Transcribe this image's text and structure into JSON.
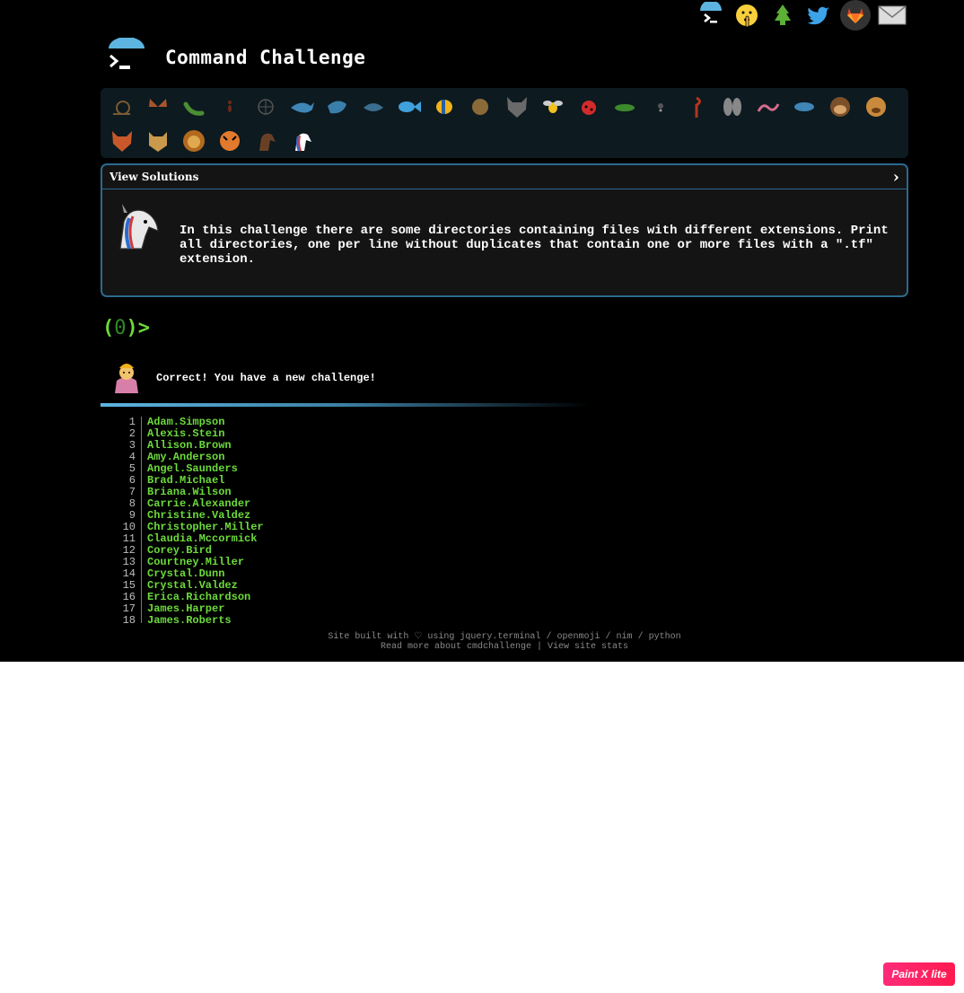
{
  "header": {
    "title": "Command Challenge",
    "icons": [
      "terminal-icon",
      "shushing-face-icon",
      "tree-icon",
      "twitter-icon",
      "gitlab-icon",
      "mail-icon"
    ]
  },
  "challenges": {
    "items": [
      "snail",
      "butterfly",
      "caterpillar",
      "ant",
      "snowflake",
      "whale",
      "dolphin",
      "dolphin-2",
      "fish",
      "tropical-fish",
      "blowfish",
      "wolf",
      "bee",
      "ladybug",
      "cricket",
      "spider",
      "scorpion",
      "fly",
      "worm",
      "microbe",
      "monkey",
      "dog",
      "fox",
      "cat",
      "lion",
      "tiger",
      "horse",
      "unicorn"
    ]
  },
  "panel": {
    "view_solutions": "View Solutions",
    "chevron": "›",
    "description": "In this challenge there are some directories containing files with different extensions. Print all directories, one per line without duplicates that contain one or more files with a \".tf\" extension."
  },
  "prompt": {
    "open": "(",
    "zero": "0",
    "close": ")>"
  },
  "result": {
    "text": "Correct! You have a new challenge!"
  },
  "output": [
    {
      "n": "1",
      "v": "Adam.Simpson"
    },
    {
      "n": "2",
      "v": "Alexis.Stein"
    },
    {
      "n": "3",
      "v": "Allison.Brown"
    },
    {
      "n": "4",
      "v": "Amy.Anderson"
    },
    {
      "n": "5",
      "v": "Angel.Saunders"
    },
    {
      "n": "6",
      "v": "Brad.Michael"
    },
    {
      "n": "7",
      "v": "Briana.Wilson"
    },
    {
      "n": "8",
      "v": "Carrie.Alexander"
    },
    {
      "n": "9",
      "v": "Christine.Valdez"
    },
    {
      "n": "10",
      "v": "Christopher.Miller"
    },
    {
      "n": "11",
      "v": "Claudia.Mccormick"
    },
    {
      "n": "12",
      "v": "Corey.Bird"
    },
    {
      "n": "13",
      "v": "Courtney.Miller"
    },
    {
      "n": "14",
      "v": "Crystal.Dunn"
    },
    {
      "n": "15",
      "v": "Crystal.Valdez"
    },
    {
      "n": "16",
      "v": "Erica.Richardson"
    },
    {
      "n": "17",
      "v": "James.Harper"
    },
    {
      "n": "18",
      "v": "James.Roberts"
    }
  ],
  "footer": {
    "line1_prefix": "Site built with ♡ using",
    "link_jquery": "jquery.terminal",
    "sep1": "/",
    "link_openmoji": "openmoji",
    "sep2": "/",
    "link_nim": "nim",
    "sep3": "/",
    "link_python": "python",
    "link_readmore": "Read more about cmdchallenge",
    "pipe": "|",
    "link_stats": "View site stats"
  },
  "badge": {
    "text": "Paint X lite"
  },
  "colors": {
    "accent": "#5db4e0",
    "green": "#6cda3b",
    "panel_border": "#2a6b8f"
  }
}
